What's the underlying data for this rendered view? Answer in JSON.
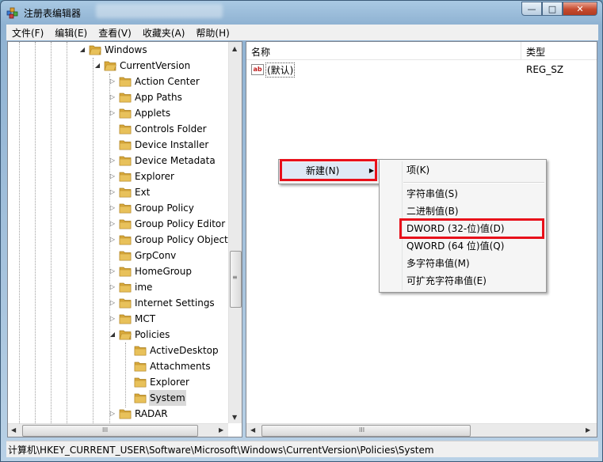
{
  "window": {
    "title": "注册表编辑器",
    "buttons": {
      "minimize": "—",
      "maximize": "□",
      "close": "✕"
    }
  },
  "menubar": [
    "文件(F)",
    "编辑(E)",
    "查看(V)",
    "收藏夹(A)",
    "帮助(H)"
  ],
  "tree": [
    {
      "label": "Windows",
      "expander": "open",
      "selected": false
    },
    {
      "label": "CurrentVersion",
      "expander": "open",
      "selected": false
    },
    {
      "label": "Action Center",
      "expander": "closed",
      "selected": false
    },
    {
      "label": "App Paths",
      "expander": "closed",
      "selected": false
    },
    {
      "label": "Applets",
      "expander": "closed",
      "selected": false
    },
    {
      "label": "Controls Folder",
      "expander": "none",
      "selected": false
    },
    {
      "label": "Device Installer",
      "expander": "none",
      "selected": false
    },
    {
      "label": "Device Metadata",
      "expander": "closed",
      "selected": false
    },
    {
      "label": "Explorer",
      "expander": "closed",
      "selected": false
    },
    {
      "label": "Ext",
      "expander": "closed",
      "selected": false
    },
    {
      "label": "Group Policy",
      "expander": "closed",
      "selected": false
    },
    {
      "label": "Group Policy Editor",
      "expander": "closed",
      "selected": false
    },
    {
      "label": "Group Policy Objects",
      "expander": "closed",
      "selected": false
    },
    {
      "label": "GrpConv",
      "expander": "none",
      "selected": false
    },
    {
      "label": "HomeGroup",
      "expander": "closed",
      "selected": false
    },
    {
      "label": "ime",
      "expander": "closed",
      "selected": false
    },
    {
      "label": "Internet Settings",
      "expander": "closed",
      "selected": false
    },
    {
      "label": "MCT",
      "expander": "closed",
      "selected": false
    },
    {
      "label": "Policies",
      "expander": "open",
      "selected": false
    },
    {
      "label": "ActiveDesktop",
      "expander": "none",
      "selected": false
    },
    {
      "label": "Attachments",
      "expander": "none",
      "selected": false
    },
    {
      "label": "Explorer",
      "expander": "none",
      "selected": false
    },
    {
      "label": "System",
      "expander": "none",
      "selected": true
    },
    {
      "label": "RADAR",
      "expander": "closed",
      "selected": false
    }
  ],
  "scroll": {
    "up": "▲",
    "down": "▼",
    "left": "◀",
    "right": "▶",
    "grip_v": "≡",
    "grip_h": "III"
  },
  "list": {
    "headers": {
      "name": "名称",
      "type": "类型"
    },
    "rows": [
      {
        "icon": "ab",
        "name": "(默认)",
        "type": "REG_SZ"
      }
    ]
  },
  "context_menu": {
    "new_label": "新建(N)",
    "submenu_arrow": "▶"
  },
  "submenu": {
    "items": [
      "项(K)",
      "字符串值(S)",
      "二进制值(B)",
      "DWORD (32-位)值(D)",
      "QWORD (64 位)值(Q)",
      "多字符串值(M)",
      "可扩充字符串值(E)"
    ]
  },
  "statusbar": {
    "path": "计算机\\HKEY_CURRENT_USER\\Software\\Microsoft\\Windows\\CurrentVersion\\Policies\\System"
  },
  "colors": {
    "highlight_box": "#e8101a",
    "folder": "#e8c15a"
  }
}
